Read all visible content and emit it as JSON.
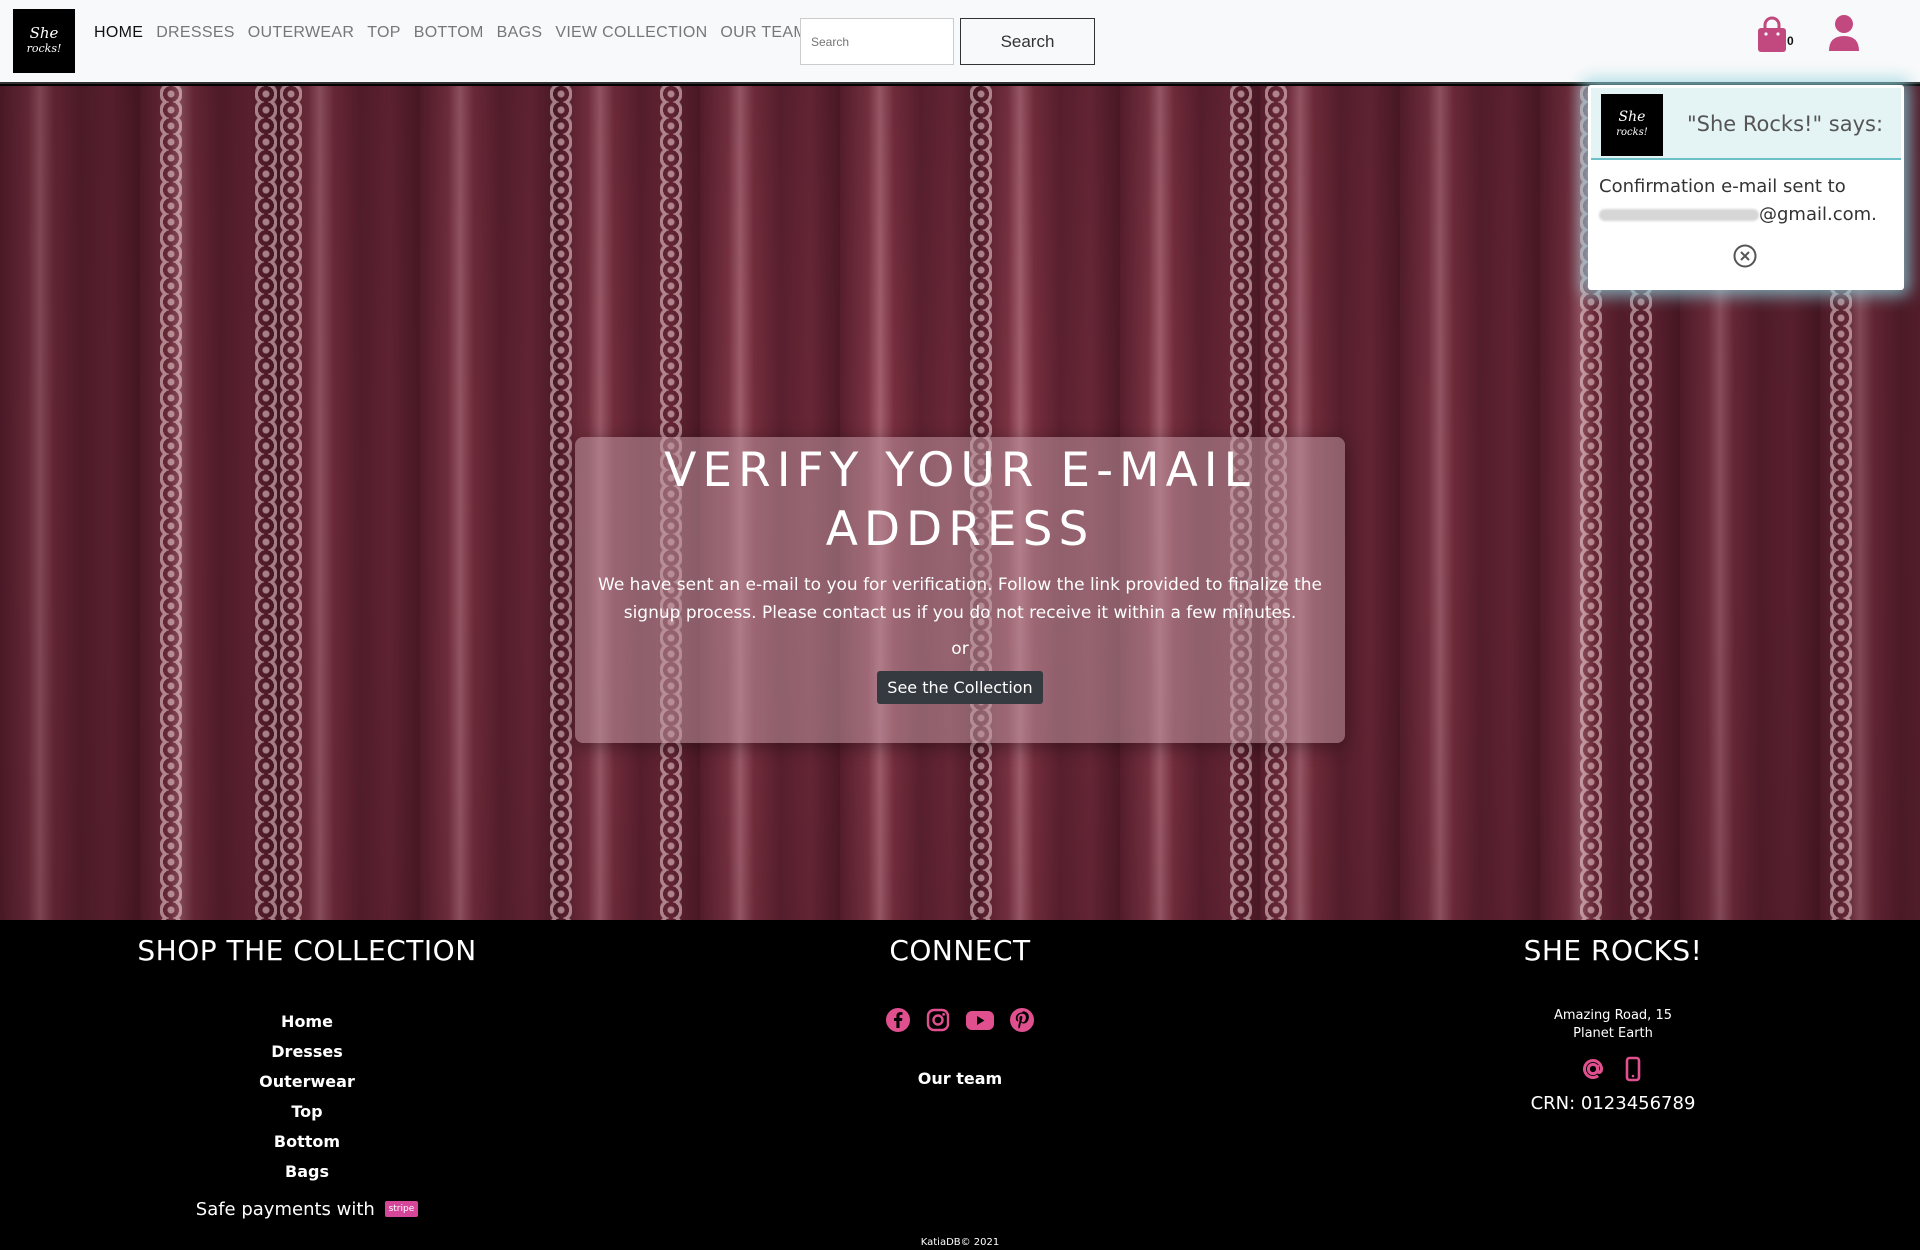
{
  "brand": {
    "logo_line1": "She",
    "logo_line2": "rocks!"
  },
  "nav": {
    "items": [
      {
        "label": "HOME",
        "active": true
      },
      {
        "label": "DRESSES"
      },
      {
        "label": "OUTERWEAR"
      },
      {
        "label": "TOP"
      },
      {
        "label": "BOTTOM"
      },
      {
        "label": "BAGS"
      },
      {
        "label": "VIEW COLLECTION"
      },
      {
        "label": "OUR TEAM"
      }
    ]
  },
  "search": {
    "placeholder": "Search",
    "button_label": "Search"
  },
  "cart": {
    "count": "0",
    "icon": "shopping-bag-icon",
    "color": "#c2497f"
  },
  "user": {
    "icon": "user-icon",
    "color": "#c2497f"
  },
  "hero": {
    "title": "VERIFY YOUR E-MAIL ADDRESS",
    "text": "We have sent an e-mail to you for verification. Follow the link provided to finalize the signup process. Please contact us if you do not receive it within a few minutes.",
    "or": "or",
    "button_label": "See the Collection"
  },
  "toast": {
    "title": "\"She Rocks!\" says:",
    "message_line1": "Confirmation e-mail sent to",
    "email_suffix": "@gmail.com.",
    "close_icon": "close-circle-icon"
  },
  "footer": {
    "shop": {
      "heading": "SHOP THE COLLECTION",
      "links": [
        "Home",
        "Dresses",
        "Outerwear",
        "Top",
        "Bottom",
        "Bags"
      ],
      "safe_payments": "Safe payments with",
      "stripe_badge": "stripe"
    },
    "connect": {
      "heading": "CONNECT",
      "social_icons": [
        "facebook-icon",
        "instagram-icon",
        "youtube-icon",
        "pinterest-icon"
      ],
      "our_team": "Our team"
    },
    "company": {
      "heading": "SHE ROCKS!",
      "address_line1": "Amazing Road, 15",
      "address_line2": "Planet Earth",
      "crn": "CRN: 0123456789"
    },
    "copyright": "KatiaDB© 2021",
    "accent": "#e0508f"
  }
}
